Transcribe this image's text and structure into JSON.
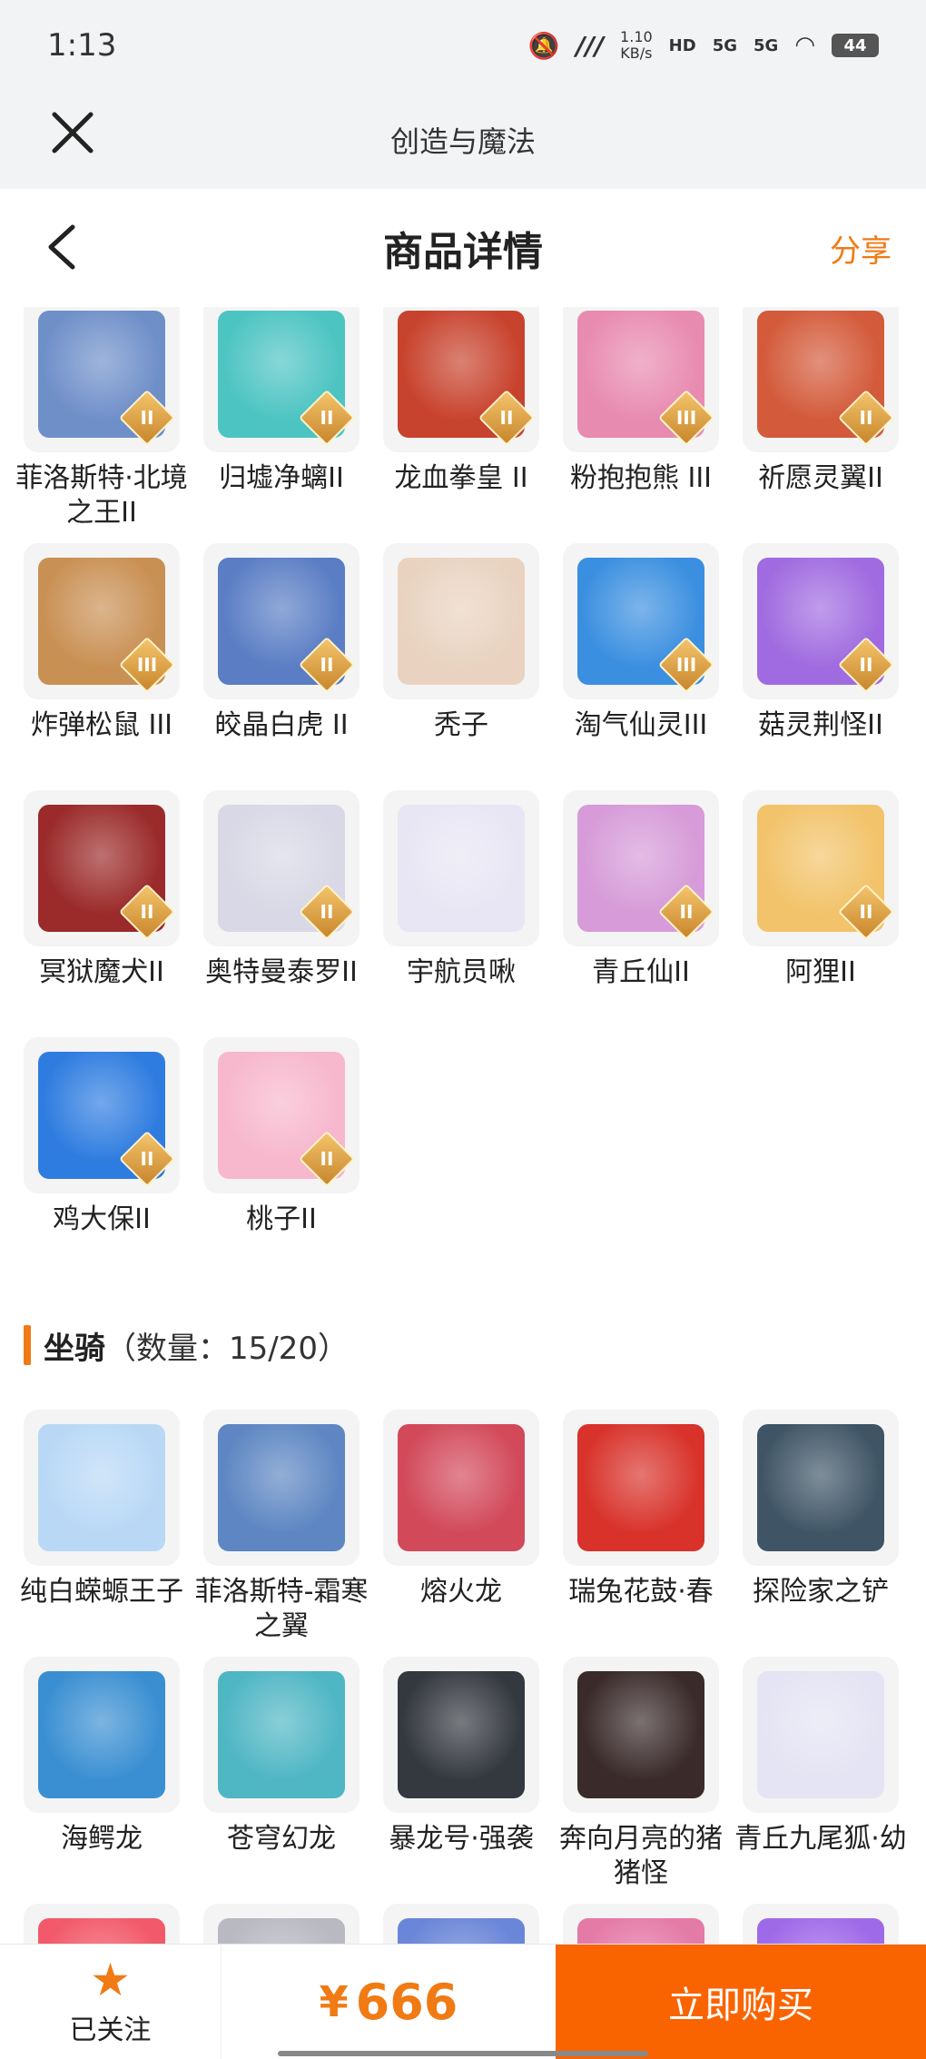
{
  "status_bar": {
    "time": "1:13",
    "net_speed": "1.10",
    "net_unit": "KB/s",
    "hd": "HD",
    "sig1": "5G",
    "sig2": "5G",
    "battery": "44"
  },
  "app_bar": {
    "title": "创造与魔法"
  },
  "header": {
    "title": "商品详情",
    "share": "分享"
  },
  "pets": [
    {
      "name": "菲洛斯特·北境之王II",
      "badge": "II",
      "color": "#6f8fc9"
    },
    {
      "name": "归墟净螭II",
      "badge": "II",
      "color": "#4cc4c2"
    },
    {
      "name": "龙血拳皇 II",
      "badge": "II",
      "color": "#c8432e"
    },
    {
      "name": "粉抱抱熊 III",
      "badge": "III",
      "color": "#e88bb0"
    },
    {
      "name": "祈愿灵翼II",
      "badge": "II",
      "color": "#d35a3a"
    },
    {
      "name": "炸弹松鼠 III",
      "badge": "III",
      "color": "#c99054"
    },
    {
      "name": "皎晶白虎 II",
      "badge": "II",
      "color": "#5a7dc4"
    },
    {
      "name": "秃子",
      "badge": "",
      "color": "#e9d3c0"
    },
    {
      "name": "淘气仙灵III",
      "badge": "III",
      "color": "#3b8fe0"
    },
    {
      "name": "菇灵荆怪II",
      "badge": "II",
      "color": "#a06be0"
    },
    {
      "name": "冥狱魔犬II",
      "badge": "II",
      "color": "#9b2a2a"
    },
    {
      "name": "奥特曼泰罗II",
      "badge": "II",
      "color": "#d8d8e6"
    },
    {
      "name": "宇航员啾",
      "badge": "",
      "color": "#e8e6f4"
    },
    {
      "name": "青丘仙II",
      "badge": "II",
      "color": "#d69bd8"
    },
    {
      "name": "阿狸II",
      "badge": "II",
      "color": "#f2c36a"
    },
    {
      "name": "鸡大保II",
      "badge": "II",
      "color": "#2e7ce0"
    },
    {
      "name": "桃子II",
      "badge": "II",
      "color": "#f7b7cd"
    }
  ],
  "mount_section": {
    "title": "坐骑",
    "count": "（数量：15/20）"
  },
  "mounts": [
    {
      "name": "纯白蝾螈王子",
      "color": "#b9d8f6"
    },
    {
      "name": "菲洛斯特-霜寒之翼",
      "color": "#5d86c2"
    },
    {
      "name": "熔火龙",
      "color": "#d2495a"
    },
    {
      "name": "瑞兔花鼓·春",
      "color": "#d8322a"
    },
    {
      "name": "探险家之铲",
      "color": "#3f5566"
    },
    {
      "name": "海鳄龙",
      "color": "#3a8fd2"
    },
    {
      "name": "苍穹幻龙",
      "color": "#4fb6c4"
    },
    {
      "name": "暴龙号·强袭",
      "color": "#34383f"
    },
    {
      "name": "奔向月亮的猪猪怪",
      "color": "#3a2a2a"
    },
    {
      "name": "青丘九尾狐·幼",
      "color": "#e4e4f4"
    },
    {
      "name": "",
      "color": "#f25a6b"
    },
    {
      "name": "",
      "color": "#b9b9c2"
    },
    {
      "name": "",
      "color": "#6a86d8"
    },
    {
      "name": "",
      "color": "#e47aa6"
    },
    {
      "name": "",
      "color": "#9f6ae8"
    }
  ],
  "bottom_bar": {
    "follow_label": "已关注",
    "currency": "¥",
    "price": "666",
    "buy_label": "立即购买"
  }
}
